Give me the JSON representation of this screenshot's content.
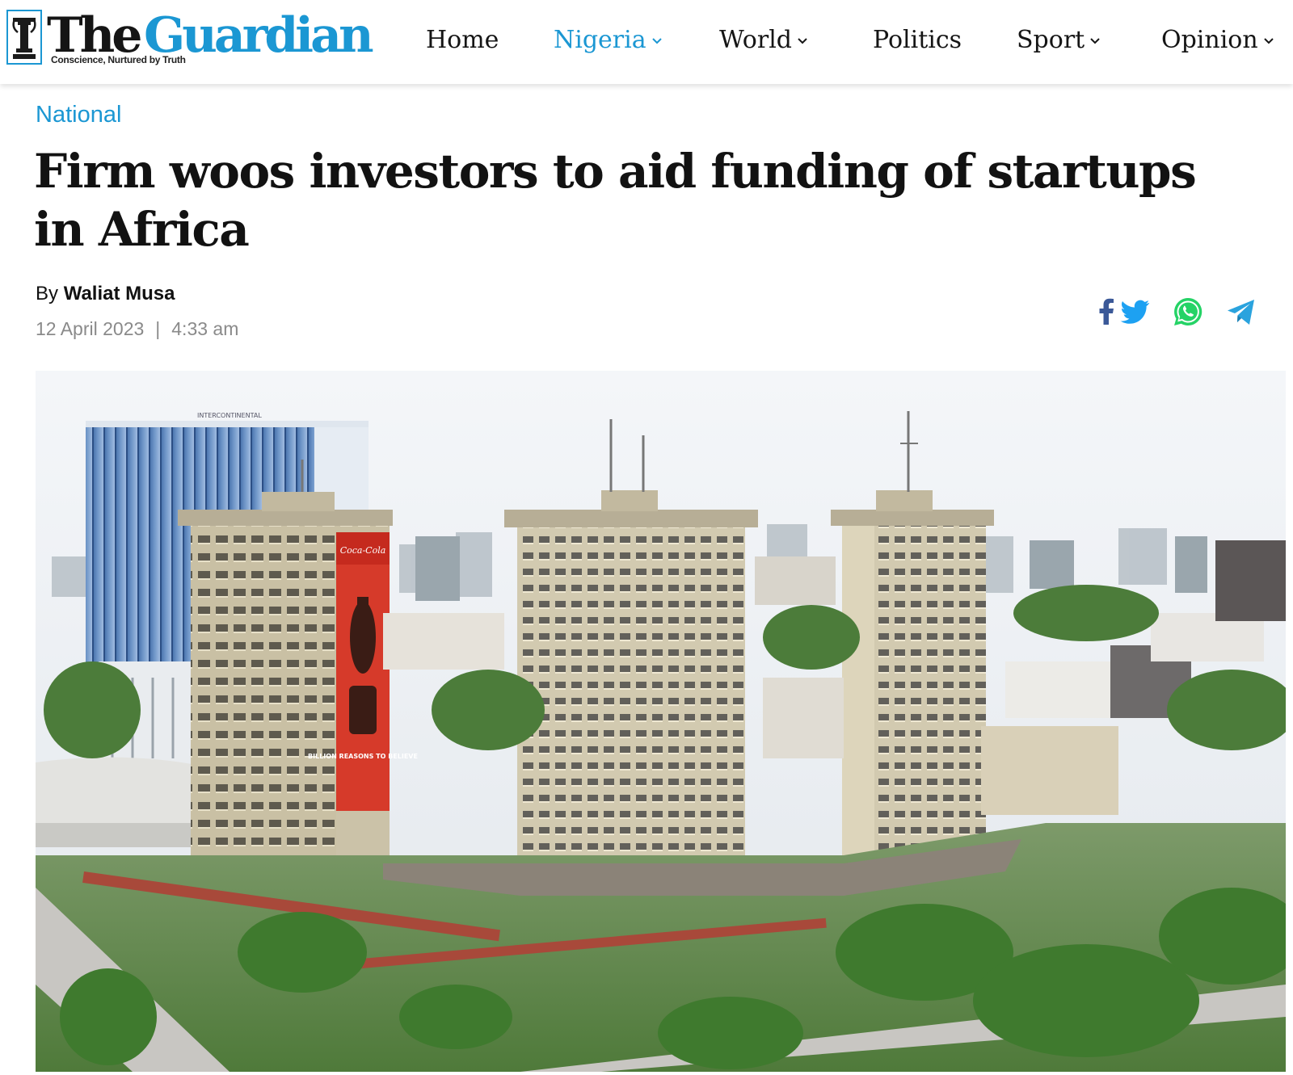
{
  "site": {
    "logo_the": "The",
    "logo_guardian": "Guardian",
    "tagline": "Conscience, Nurtured by Truth"
  },
  "nav": {
    "items": [
      {
        "label": "Home",
        "dropdown": false,
        "active": false
      },
      {
        "label": "Nigeria",
        "dropdown": true,
        "active": true
      },
      {
        "label": "World",
        "dropdown": true,
        "active": false
      },
      {
        "label": "Politics",
        "dropdown": false,
        "active": false
      },
      {
        "label": "Sport",
        "dropdown": true,
        "active": false
      },
      {
        "label": "Opinion",
        "dropdown": true,
        "active": false
      }
    ]
  },
  "article": {
    "category": "National",
    "headline": "Firm woos investors to aid funding of startups in Africa",
    "by_prefix": "By",
    "author": "Waliat Musa",
    "date": "12 April 2023",
    "separator": "|",
    "time": "4:33 am"
  },
  "share": {
    "icons": [
      "facebook-icon",
      "twitter-icon",
      "whatsapp-icon",
      "telegram-icon"
    ]
  },
  "hero": {
    "billboard_brand": "Coca-Cola",
    "billboard_slogan": "BILLION REASONS TO BELIEVE",
    "hotel_sign": "INTERCONTINENTAL"
  },
  "colors": {
    "brand_blue": "#1b97d3",
    "headline": "#121212",
    "meta_gray": "#8a8a8a",
    "facebook": "#3b5998",
    "twitter": "#1da1f2",
    "whatsapp": "#25d366",
    "telegram": "#2aa3de"
  }
}
